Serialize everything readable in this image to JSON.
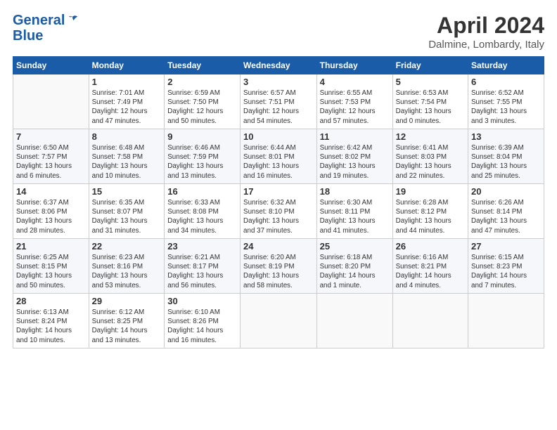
{
  "logo": {
    "line1": "General",
    "line2": "Blue"
  },
  "title": "April 2024",
  "location": "Dalmine, Lombardy, Italy",
  "days_of_week": [
    "Sunday",
    "Monday",
    "Tuesday",
    "Wednesday",
    "Thursday",
    "Friday",
    "Saturday"
  ],
  "weeks": [
    [
      {
        "day": "",
        "content": ""
      },
      {
        "day": "1",
        "content": "Sunrise: 7:01 AM\nSunset: 7:49 PM\nDaylight: 12 hours\nand 47 minutes."
      },
      {
        "day": "2",
        "content": "Sunrise: 6:59 AM\nSunset: 7:50 PM\nDaylight: 12 hours\nand 50 minutes."
      },
      {
        "day": "3",
        "content": "Sunrise: 6:57 AM\nSunset: 7:51 PM\nDaylight: 12 hours\nand 54 minutes."
      },
      {
        "day": "4",
        "content": "Sunrise: 6:55 AM\nSunset: 7:53 PM\nDaylight: 12 hours\nand 57 minutes."
      },
      {
        "day": "5",
        "content": "Sunrise: 6:53 AM\nSunset: 7:54 PM\nDaylight: 13 hours\nand 0 minutes."
      },
      {
        "day": "6",
        "content": "Sunrise: 6:52 AM\nSunset: 7:55 PM\nDaylight: 13 hours\nand 3 minutes."
      }
    ],
    [
      {
        "day": "7",
        "content": "Sunrise: 6:50 AM\nSunset: 7:57 PM\nDaylight: 13 hours\nand 6 minutes."
      },
      {
        "day": "8",
        "content": "Sunrise: 6:48 AM\nSunset: 7:58 PM\nDaylight: 13 hours\nand 10 minutes."
      },
      {
        "day": "9",
        "content": "Sunrise: 6:46 AM\nSunset: 7:59 PM\nDaylight: 13 hours\nand 13 minutes."
      },
      {
        "day": "10",
        "content": "Sunrise: 6:44 AM\nSunset: 8:01 PM\nDaylight: 13 hours\nand 16 minutes."
      },
      {
        "day": "11",
        "content": "Sunrise: 6:42 AM\nSunset: 8:02 PM\nDaylight: 13 hours\nand 19 minutes."
      },
      {
        "day": "12",
        "content": "Sunrise: 6:41 AM\nSunset: 8:03 PM\nDaylight: 13 hours\nand 22 minutes."
      },
      {
        "day": "13",
        "content": "Sunrise: 6:39 AM\nSunset: 8:04 PM\nDaylight: 13 hours\nand 25 minutes."
      }
    ],
    [
      {
        "day": "14",
        "content": "Sunrise: 6:37 AM\nSunset: 8:06 PM\nDaylight: 13 hours\nand 28 minutes."
      },
      {
        "day": "15",
        "content": "Sunrise: 6:35 AM\nSunset: 8:07 PM\nDaylight: 13 hours\nand 31 minutes."
      },
      {
        "day": "16",
        "content": "Sunrise: 6:33 AM\nSunset: 8:08 PM\nDaylight: 13 hours\nand 34 minutes."
      },
      {
        "day": "17",
        "content": "Sunrise: 6:32 AM\nSunset: 8:10 PM\nDaylight: 13 hours\nand 37 minutes."
      },
      {
        "day": "18",
        "content": "Sunrise: 6:30 AM\nSunset: 8:11 PM\nDaylight: 13 hours\nand 41 minutes."
      },
      {
        "day": "19",
        "content": "Sunrise: 6:28 AM\nSunset: 8:12 PM\nDaylight: 13 hours\nand 44 minutes."
      },
      {
        "day": "20",
        "content": "Sunrise: 6:26 AM\nSunset: 8:14 PM\nDaylight: 13 hours\nand 47 minutes."
      }
    ],
    [
      {
        "day": "21",
        "content": "Sunrise: 6:25 AM\nSunset: 8:15 PM\nDaylight: 13 hours\nand 50 minutes."
      },
      {
        "day": "22",
        "content": "Sunrise: 6:23 AM\nSunset: 8:16 PM\nDaylight: 13 hours\nand 53 minutes."
      },
      {
        "day": "23",
        "content": "Sunrise: 6:21 AM\nSunset: 8:17 PM\nDaylight: 13 hours\nand 56 minutes."
      },
      {
        "day": "24",
        "content": "Sunrise: 6:20 AM\nSunset: 8:19 PM\nDaylight: 13 hours\nand 58 minutes."
      },
      {
        "day": "25",
        "content": "Sunrise: 6:18 AM\nSunset: 8:20 PM\nDaylight: 14 hours\nand 1 minute."
      },
      {
        "day": "26",
        "content": "Sunrise: 6:16 AM\nSunset: 8:21 PM\nDaylight: 14 hours\nand 4 minutes."
      },
      {
        "day": "27",
        "content": "Sunrise: 6:15 AM\nSunset: 8:23 PM\nDaylight: 14 hours\nand 7 minutes."
      }
    ],
    [
      {
        "day": "28",
        "content": "Sunrise: 6:13 AM\nSunset: 8:24 PM\nDaylight: 14 hours\nand 10 minutes."
      },
      {
        "day": "29",
        "content": "Sunrise: 6:12 AM\nSunset: 8:25 PM\nDaylight: 14 hours\nand 13 minutes."
      },
      {
        "day": "30",
        "content": "Sunrise: 6:10 AM\nSunset: 8:26 PM\nDaylight: 14 hours\nand 16 minutes."
      },
      {
        "day": "",
        "content": ""
      },
      {
        "day": "",
        "content": ""
      },
      {
        "day": "",
        "content": ""
      },
      {
        "day": "",
        "content": ""
      }
    ]
  ]
}
